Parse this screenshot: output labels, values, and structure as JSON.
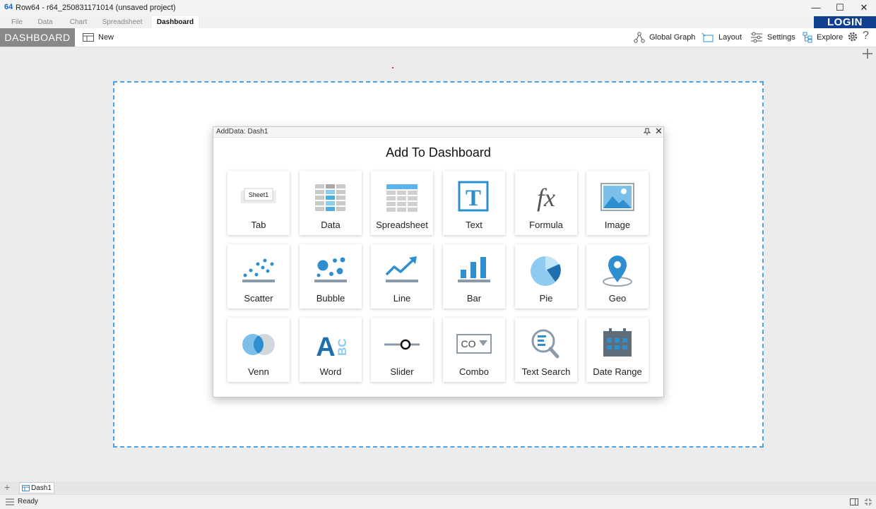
{
  "window": {
    "app_icon": "64",
    "title": "Row64 - r64_250831171014 (unsaved project)",
    "minimize": "—",
    "maximize": "☐",
    "close": "✕"
  },
  "menu": {
    "tabs": [
      "File",
      "Data",
      "Chart",
      "Spreadsheet",
      "Dashboard"
    ],
    "active": "Dashboard",
    "login": "LOGIN"
  },
  "toolbar": {
    "mode": "DASHBOARD",
    "new": "New",
    "global_graph": "Global Graph",
    "layout": "Layout",
    "settings": "Settings",
    "explore": "Explore",
    "help": "?"
  },
  "dialog": {
    "title": "AddData: Dash1",
    "heading": "Add To Dashboard",
    "close": "✕",
    "items": [
      {
        "label": "Tab",
        "icon": "tab-icon",
        "icon_text": "Sheet1"
      },
      {
        "label": "Data",
        "icon": "data-table-icon"
      },
      {
        "label": "Spreadsheet",
        "icon": "spreadsheet-icon"
      },
      {
        "label": "Text",
        "icon": "text-icon",
        "icon_text": "T"
      },
      {
        "label": "Formula",
        "icon": "formula-icon",
        "icon_text": "fx"
      },
      {
        "label": "Image",
        "icon": "image-icon"
      },
      {
        "label": "Scatter",
        "icon": "scatter-icon"
      },
      {
        "label": "Bubble",
        "icon": "bubble-icon"
      },
      {
        "label": "Line",
        "icon": "line-chart-icon"
      },
      {
        "label": "Bar",
        "icon": "bar-chart-icon"
      },
      {
        "label": "Pie",
        "icon": "pie-chart-icon"
      },
      {
        "label": "Geo",
        "icon": "map-pin-icon"
      },
      {
        "label": "Venn",
        "icon": "venn-icon"
      },
      {
        "label": "Word",
        "icon": "word-icon",
        "icon_text": "A",
        "icon_text2": "BC"
      },
      {
        "label": "Slider",
        "icon": "slider-icon"
      },
      {
        "label": "Combo",
        "icon": "combo-icon",
        "icon_text": "CO"
      },
      {
        "label": "Text Search",
        "icon": "text-search-icon"
      },
      {
        "label": "Date Range",
        "icon": "calendar-icon"
      }
    ]
  },
  "bottom": {
    "add_tab": "+",
    "tab": "Dash1"
  },
  "status": {
    "text": "Ready"
  },
  "colors": {
    "accent": "#2d8fd0",
    "accent_light": "#9fcdf0",
    "icon_gray": "#8a9aa8",
    "login_bg": "#0f3f8e",
    "canvas_border": "#4aa3e6"
  }
}
